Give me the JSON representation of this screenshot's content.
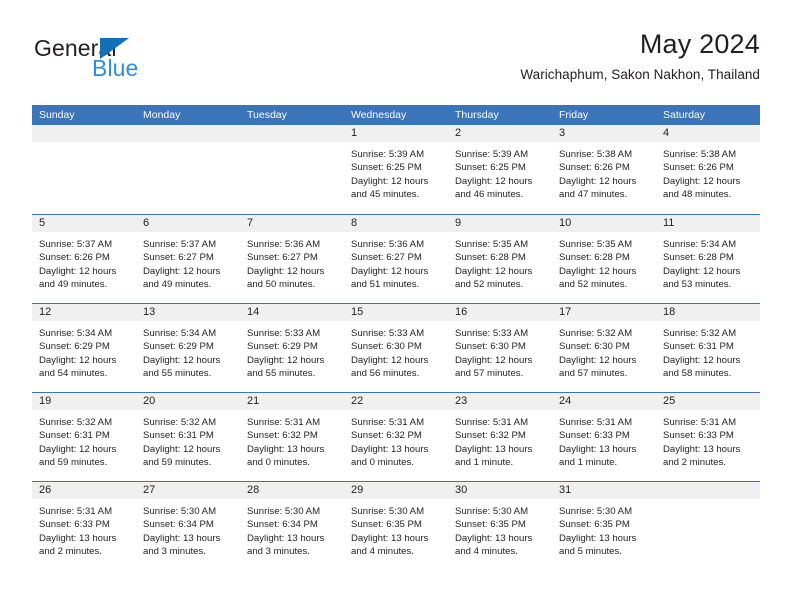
{
  "brand": {
    "name_top": "General",
    "name_bottom": "Blue",
    "triangle_color": "#136FB7",
    "blue_text_color": "#2F8FD4"
  },
  "header": {
    "title": "May 2024",
    "subtitle": "Warichaphum, Sakon Nakhon, Thailand"
  },
  "colors": {
    "header_band": "#3B74B8",
    "daynum_band": "#F0F0F0",
    "text": "#231F20",
    "week_rule": "#3B74B8"
  },
  "weekdays": [
    "Sunday",
    "Monday",
    "Tuesday",
    "Wednesday",
    "Thursday",
    "Friday",
    "Saturday"
  ],
  "weeks": [
    [
      {
        "day": "",
        "sunrise": "",
        "sunset": "",
        "daylight_l1": "",
        "daylight_l2": ""
      },
      {
        "day": "",
        "sunrise": "",
        "sunset": "",
        "daylight_l1": "",
        "daylight_l2": ""
      },
      {
        "day": "",
        "sunrise": "",
        "sunset": "",
        "daylight_l1": "",
        "daylight_l2": ""
      },
      {
        "day": "1",
        "sunrise": "Sunrise: 5:39 AM",
        "sunset": "Sunset: 6:25 PM",
        "daylight_l1": "Daylight: 12 hours",
        "daylight_l2": "and 45 minutes."
      },
      {
        "day": "2",
        "sunrise": "Sunrise: 5:39 AM",
        "sunset": "Sunset: 6:25 PM",
        "daylight_l1": "Daylight: 12 hours",
        "daylight_l2": "and 46 minutes."
      },
      {
        "day": "3",
        "sunrise": "Sunrise: 5:38 AM",
        "sunset": "Sunset: 6:26 PM",
        "daylight_l1": "Daylight: 12 hours",
        "daylight_l2": "and 47 minutes."
      },
      {
        "day": "4",
        "sunrise": "Sunrise: 5:38 AM",
        "sunset": "Sunset: 6:26 PM",
        "daylight_l1": "Daylight: 12 hours",
        "daylight_l2": "and 48 minutes."
      }
    ],
    [
      {
        "day": "5",
        "sunrise": "Sunrise: 5:37 AM",
        "sunset": "Sunset: 6:26 PM",
        "daylight_l1": "Daylight: 12 hours",
        "daylight_l2": "and 49 minutes."
      },
      {
        "day": "6",
        "sunrise": "Sunrise: 5:37 AM",
        "sunset": "Sunset: 6:27 PM",
        "daylight_l1": "Daylight: 12 hours",
        "daylight_l2": "and 49 minutes."
      },
      {
        "day": "7",
        "sunrise": "Sunrise: 5:36 AM",
        "sunset": "Sunset: 6:27 PM",
        "daylight_l1": "Daylight: 12 hours",
        "daylight_l2": "and 50 minutes."
      },
      {
        "day": "8",
        "sunrise": "Sunrise: 5:36 AM",
        "sunset": "Sunset: 6:27 PM",
        "daylight_l1": "Daylight: 12 hours",
        "daylight_l2": "and 51 minutes."
      },
      {
        "day": "9",
        "sunrise": "Sunrise: 5:35 AM",
        "sunset": "Sunset: 6:28 PM",
        "daylight_l1": "Daylight: 12 hours",
        "daylight_l2": "and 52 minutes."
      },
      {
        "day": "10",
        "sunrise": "Sunrise: 5:35 AM",
        "sunset": "Sunset: 6:28 PM",
        "daylight_l1": "Daylight: 12 hours",
        "daylight_l2": "and 52 minutes."
      },
      {
        "day": "11",
        "sunrise": "Sunrise: 5:34 AM",
        "sunset": "Sunset: 6:28 PM",
        "daylight_l1": "Daylight: 12 hours",
        "daylight_l2": "and 53 minutes."
      }
    ],
    [
      {
        "day": "12",
        "sunrise": "Sunrise: 5:34 AM",
        "sunset": "Sunset: 6:29 PM",
        "daylight_l1": "Daylight: 12 hours",
        "daylight_l2": "and 54 minutes."
      },
      {
        "day": "13",
        "sunrise": "Sunrise: 5:34 AM",
        "sunset": "Sunset: 6:29 PM",
        "daylight_l1": "Daylight: 12 hours",
        "daylight_l2": "and 55 minutes."
      },
      {
        "day": "14",
        "sunrise": "Sunrise: 5:33 AM",
        "sunset": "Sunset: 6:29 PM",
        "daylight_l1": "Daylight: 12 hours",
        "daylight_l2": "and 55 minutes."
      },
      {
        "day": "15",
        "sunrise": "Sunrise: 5:33 AM",
        "sunset": "Sunset: 6:30 PM",
        "daylight_l1": "Daylight: 12 hours",
        "daylight_l2": "and 56 minutes."
      },
      {
        "day": "16",
        "sunrise": "Sunrise: 5:33 AM",
        "sunset": "Sunset: 6:30 PM",
        "daylight_l1": "Daylight: 12 hours",
        "daylight_l2": "and 57 minutes."
      },
      {
        "day": "17",
        "sunrise": "Sunrise: 5:32 AM",
        "sunset": "Sunset: 6:30 PM",
        "daylight_l1": "Daylight: 12 hours",
        "daylight_l2": "and 57 minutes."
      },
      {
        "day": "18",
        "sunrise": "Sunrise: 5:32 AM",
        "sunset": "Sunset: 6:31 PM",
        "daylight_l1": "Daylight: 12 hours",
        "daylight_l2": "and 58 minutes."
      }
    ],
    [
      {
        "day": "19",
        "sunrise": "Sunrise: 5:32 AM",
        "sunset": "Sunset: 6:31 PM",
        "daylight_l1": "Daylight: 12 hours",
        "daylight_l2": "and 59 minutes."
      },
      {
        "day": "20",
        "sunrise": "Sunrise: 5:32 AM",
        "sunset": "Sunset: 6:31 PM",
        "daylight_l1": "Daylight: 12 hours",
        "daylight_l2": "and 59 minutes."
      },
      {
        "day": "21",
        "sunrise": "Sunrise: 5:31 AM",
        "sunset": "Sunset: 6:32 PM",
        "daylight_l1": "Daylight: 13 hours",
        "daylight_l2": "and 0 minutes."
      },
      {
        "day": "22",
        "sunrise": "Sunrise: 5:31 AM",
        "sunset": "Sunset: 6:32 PM",
        "daylight_l1": "Daylight: 13 hours",
        "daylight_l2": "and 0 minutes."
      },
      {
        "day": "23",
        "sunrise": "Sunrise: 5:31 AM",
        "sunset": "Sunset: 6:32 PM",
        "daylight_l1": "Daylight: 13 hours",
        "daylight_l2": "and 1 minute."
      },
      {
        "day": "24",
        "sunrise": "Sunrise: 5:31 AM",
        "sunset": "Sunset: 6:33 PM",
        "daylight_l1": "Daylight: 13 hours",
        "daylight_l2": "and 1 minute."
      },
      {
        "day": "25",
        "sunrise": "Sunrise: 5:31 AM",
        "sunset": "Sunset: 6:33 PM",
        "daylight_l1": "Daylight: 13 hours",
        "daylight_l2": "and 2 minutes."
      }
    ],
    [
      {
        "day": "26",
        "sunrise": "Sunrise: 5:31 AM",
        "sunset": "Sunset: 6:33 PM",
        "daylight_l1": "Daylight: 13 hours",
        "daylight_l2": "and 2 minutes."
      },
      {
        "day": "27",
        "sunrise": "Sunrise: 5:30 AM",
        "sunset": "Sunset: 6:34 PM",
        "daylight_l1": "Daylight: 13 hours",
        "daylight_l2": "and 3 minutes."
      },
      {
        "day": "28",
        "sunrise": "Sunrise: 5:30 AM",
        "sunset": "Sunset: 6:34 PM",
        "daylight_l1": "Daylight: 13 hours",
        "daylight_l2": "and 3 minutes."
      },
      {
        "day": "29",
        "sunrise": "Sunrise: 5:30 AM",
        "sunset": "Sunset: 6:35 PM",
        "daylight_l1": "Daylight: 13 hours",
        "daylight_l2": "and 4 minutes."
      },
      {
        "day": "30",
        "sunrise": "Sunrise: 5:30 AM",
        "sunset": "Sunset: 6:35 PM",
        "daylight_l1": "Daylight: 13 hours",
        "daylight_l2": "and 4 minutes."
      },
      {
        "day": "31",
        "sunrise": "Sunrise: 5:30 AM",
        "sunset": "Sunset: 6:35 PM",
        "daylight_l1": "Daylight: 13 hours",
        "daylight_l2": "and 5 minutes."
      },
      {
        "day": "",
        "sunrise": "",
        "sunset": "",
        "daylight_l1": "",
        "daylight_l2": ""
      }
    ]
  ]
}
